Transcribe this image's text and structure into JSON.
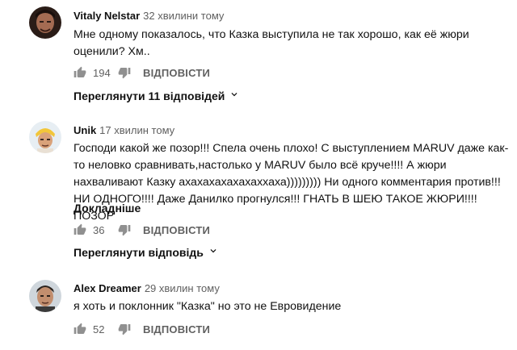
{
  "comments": [
    {
      "author": "Vitaly Nelstar",
      "time": "32 хвилини тому",
      "text": "Мне одному показалось, что Казка выступила не так хорошо, как её жюри оценили? Хм..",
      "likes": "194",
      "reply_label": "ВІДПОВІСТИ",
      "replies_label": "Переглянути 11 відповідей"
    },
    {
      "author": "Unik",
      "time": "17 хвилин тому",
      "text": "Господи какой же позор!!! Спела очень плохо! С выступлением MARUV даже как-то неловко сравнивать,настолько у MARUV было всё круче!!!! А жюри нахваливают Казку ахахахахахахаххаха)))))))))  Ни одного комментария против!!! НИ ОДНОГО!!!! Даже Данилко прогнулся!!!  ГНАТЬ В ШЕЮ ТАКОЕ ЖЮРИ!!!!  ПОЗОР",
      "more_label": "Докладніше",
      "likes": "36",
      "reply_label": "ВІДПОВІСТИ",
      "replies_label": "Переглянути відповідь"
    },
    {
      "author": "Alex Dreamer",
      "time": "29 хвилин тому",
      "text": "я хоть и поклонник \"Казка\" но это не Евровидение",
      "likes": "52",
      "reply_label": "ВІДПОВІСТИ"
    }
  ],
  "icons": {
    "like": "thumb-up-icon",
    "dislike": "thumb-down-icon",
    "expand": "chevron-down-icon"
  },
  "colors": {
    "secondary_text": "#606060",
    "icon": "#909090"
  }
}
